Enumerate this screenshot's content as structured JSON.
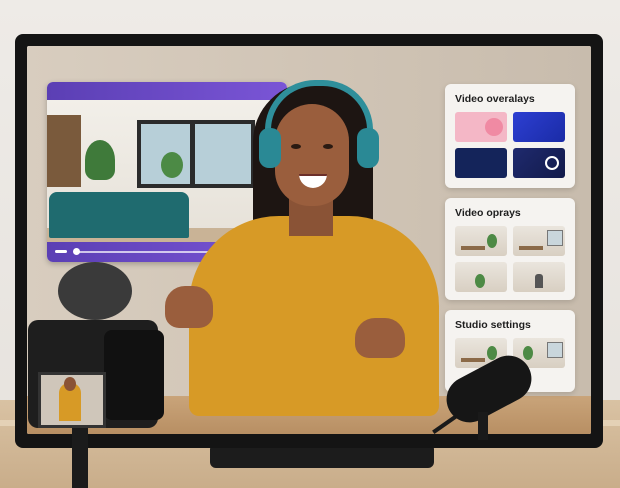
{
  "panels": {
    "overlays": {
      "title": "Video overalays"
    },
    "options": {
      "title": "Video oprays"
    },
    "studio": {
      "title": "Studio settings"
    }
  },
  "colors": {
    "accent": "#6a4ac6",
    "shirt": "#d79a26",
    "headphones": "#2f8f9b"
  },
  "icons": [
    "slider-icon",
    "ring-icon"
  ]
}
